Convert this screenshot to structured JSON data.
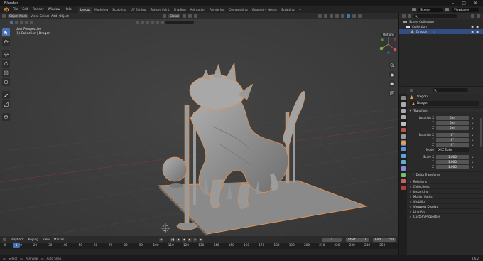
{
  "app": {
    "title": "Blender"
  },
  "menu": [
    "File",
    "Edit",
    "Render",
    "Window",
    "Help"
  ],
  "workspaces": [
    "Layout",
    "Modeling",
    "Sculpting",
    "UV Editing",
    "Texture Paint",
    "Shading",
    "Animation",
    "Rendering",
    "Compositing",
    "Geometry Nodes",
    "Scripting"
  ],
  "workspace_add": "+",
  "active_workspace": "Layout",
  "scene": {
    "name": "Scene",
    "view_layer": "ViewLayer"
  },
  "viewport": {
    "mode": "Object Mode",
    "menus": [
      "View",
      "Select",
      "Add",
      "Object"
    ],
    "transform_orientation": "Global",
    "perspective_label": "User Perspective",
    "collection_label": "(0) Collection | Dragon",
    "options_label": "Options"
  },
  "outliner": {
    "rows": [
      {
        "label": "Scene Collection"
      },
      {
        "label": "Collection"
      },
      {
        "label": "Dragon"
      }
    ]
  },
  "properties": {
    "object_name": "Dragon",
    "data_name": "Dragon",
    "transform_panel": "Transform",
    "location_label": "Location X",
    "location": [
      "0 m",
      "0 m",
      "0 m"
    ],
    "rotation_label": "Rotation X",
    "rotation": [
      "0°",
      "0°",
      "0°"
    ],
    "mode_label": "Mode",
    "mode_value": "XYZ Euler",
    "scale_label": "Scale X",
    "scale": [
      "1.000",
      "1.000",
      "1.000"
    ],
    "axis_y": "Y",
    "axis_z": "Z",
    "delta_transform": "Delta Transform",
    "panels": [
      "Relations",
      "Collections",
      "Instancing",
      "Motion Paths",
      "Visibility",
      "Viewport Display",
      "Line Art",
      "Custom Properties"
    ]
  },
  "timeline": {
    "menus": [
      "Playback",
      "Keying",
      "View",
      "Marker"
    ],
    "current_frame": "1",
    "start_label": "Start",
    "start_value": "1",
    "end_label": "End",
    "end_value": "250",
    "playhead": "1",
    "ticks": [
      "0",
      "10",
      "20",
      "30",
      "40",
      "50",
      "60",
      "70",
      "80",
      "90",
      "100",
      "110",
      "120",
      "130",
      "140",
      "150",
      "160",
      "170",
      "180",
      "190",
      "200",
      "210",
      "220",
      "230",
      "240",
      "250"
    ]
  },
  "statusbar": {
    "select": "Select",
    "pan": "Pan View",
    "snap": "Auto Snap",
    "version": "3.6.2"
  },
  "colors": {
    "accent": "#4772b3",
    "selection_outline": "#e6914a",
    "header": "#2b2b2b",
    "viewport": "#3a3a3a"
  },
  "icons": [
    "blender-logo",
    "cursor-icon",
    "move-icon",
    "rotate-icon",
    "scale-icon",
    "transform-icon",
    "annotate-icon",
    "measure-icon",
    "add-cube-icon",
    "zoom-icon",
    "hand-icon",
    "camera-icon",
    "grid-icon",
    "eye-icon",
    "camera-vis-icon",
    "search-icon"
  ]
}
